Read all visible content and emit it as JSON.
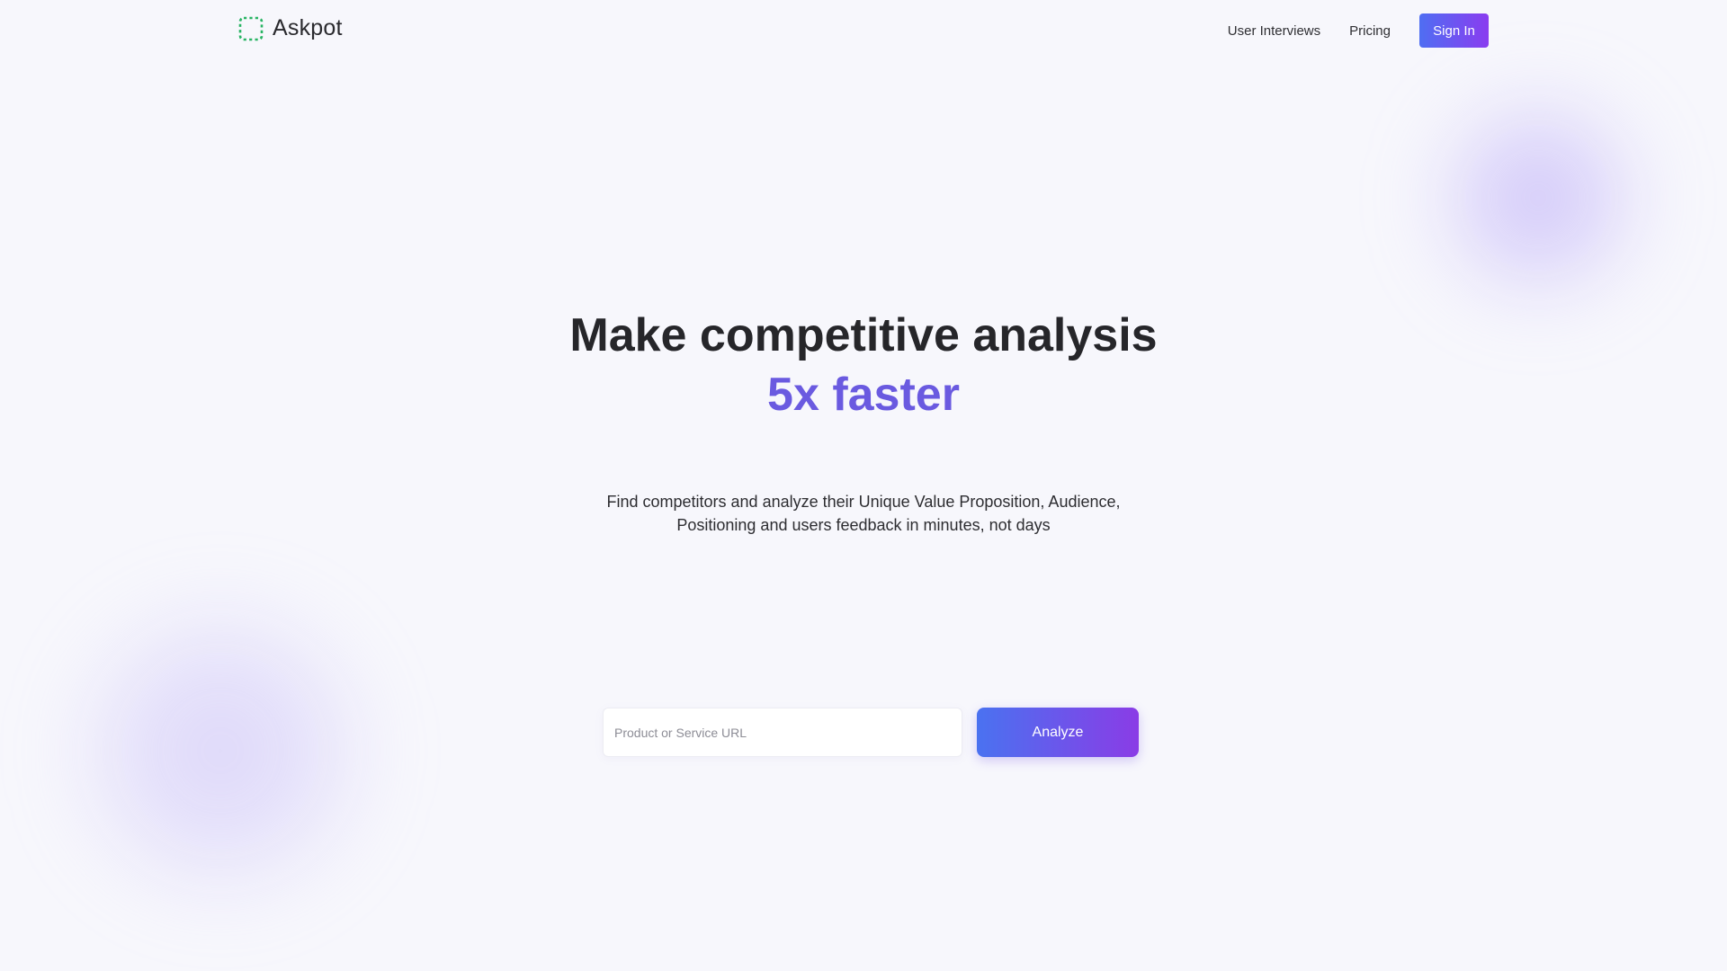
{
  "brand": {
    "name": "Askpot",
    "icon": "dashed-square-icon",
    "icon_color": "#28b463"
  },
  "nav": {
    "items": [
      {
        "label": "User Interviews"
      },
      {
        "label": "Pricing"
      }
    ],
    "signin_label": "Sign In"
  },
  "hero": {
    "headline": "Make competitive analysis",
    "headline_accent": "5x faster",
    "subtitle_line1": "Find competitors and analyze their Unique Value Proposition, Audience,",
    "subtitle_line2": "Positioning and users feedback in minutes, not days"
  },
  "form": {
    "url_placeholder": "Product or Service URL",
    "url_value": "",
    "analyze_label": "Analyze"
  },
  "colors": {
    "accent": "#6a5ae0",
    "button_gradient_start": "#4a72f0",
    "button_gradient_end": "#8a3ce6",
    "background": "#f7f7fc"
  }
}
